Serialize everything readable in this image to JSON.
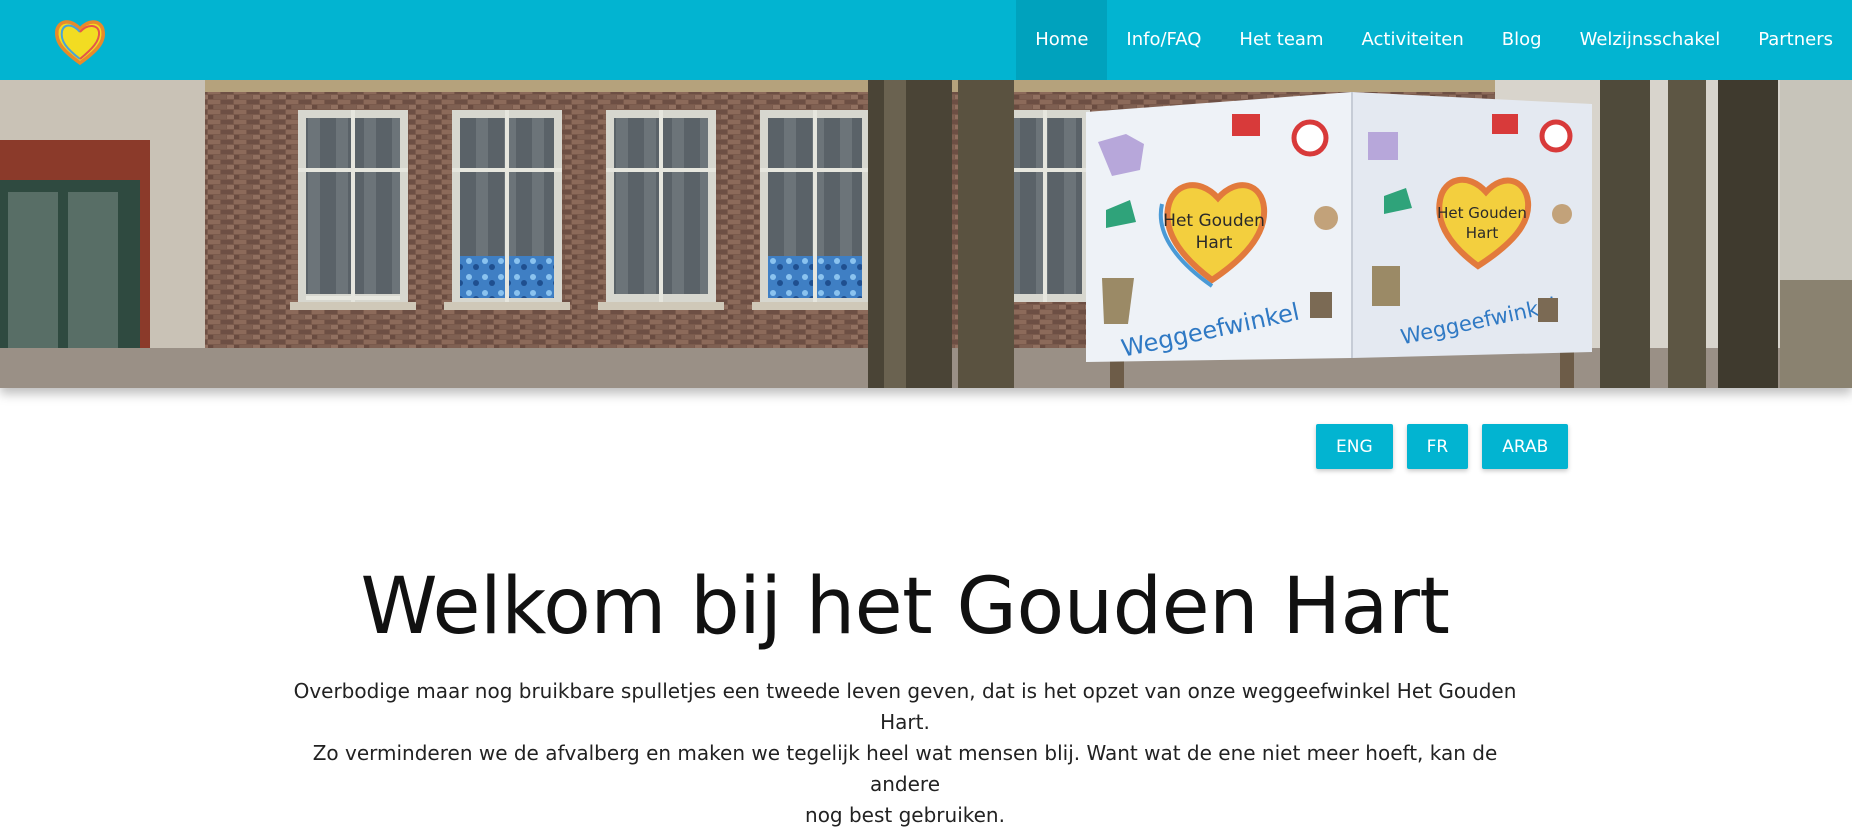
{
  "nav": {
    "logo_icon": "golden-heart-icon",
    "items": [
      {
        "label": "Home",
        "active": true
      },
      {
        "label": "Info/FAQ"
      },
      {
        "label": "Het team"
      },
      {
        "label": "Activiteiten"
      },
      {
        "label": "Blog"
      },
      {
        "label": "Welzijnsschakel"
      },
      {
        "label": "Partners"
      }
    ]
  },
  "hero": {
    "sign_text_line1": "Het Gouden",
    "sign_text_line2": "Hart",
    "sign_subtitle": "Weggeefwinkel"
  },
  "languages": [
    "ENG",
    "FR",
    "ARAB"
  ],
  "main": {
    "title": "Welkom bij het Gouden Hart",
    "intro_lines": [
      "Overbodige maar nog bruikbare spulletjes een tweede leven geven, dat is het opzet van onze weggeefwinkel Het Gouden Hart.",
      "Zo verminderen we de afvalberg en maken we tegelijk heel wat mensen blij. Want wat de ene niet meer hoeft, kan de andere",
      "nog best gebruiken."
    ]
  },
  "colors": {
    "brand": "#02b4d1",
    "brand_active": "#00a2bd"
  }
}
